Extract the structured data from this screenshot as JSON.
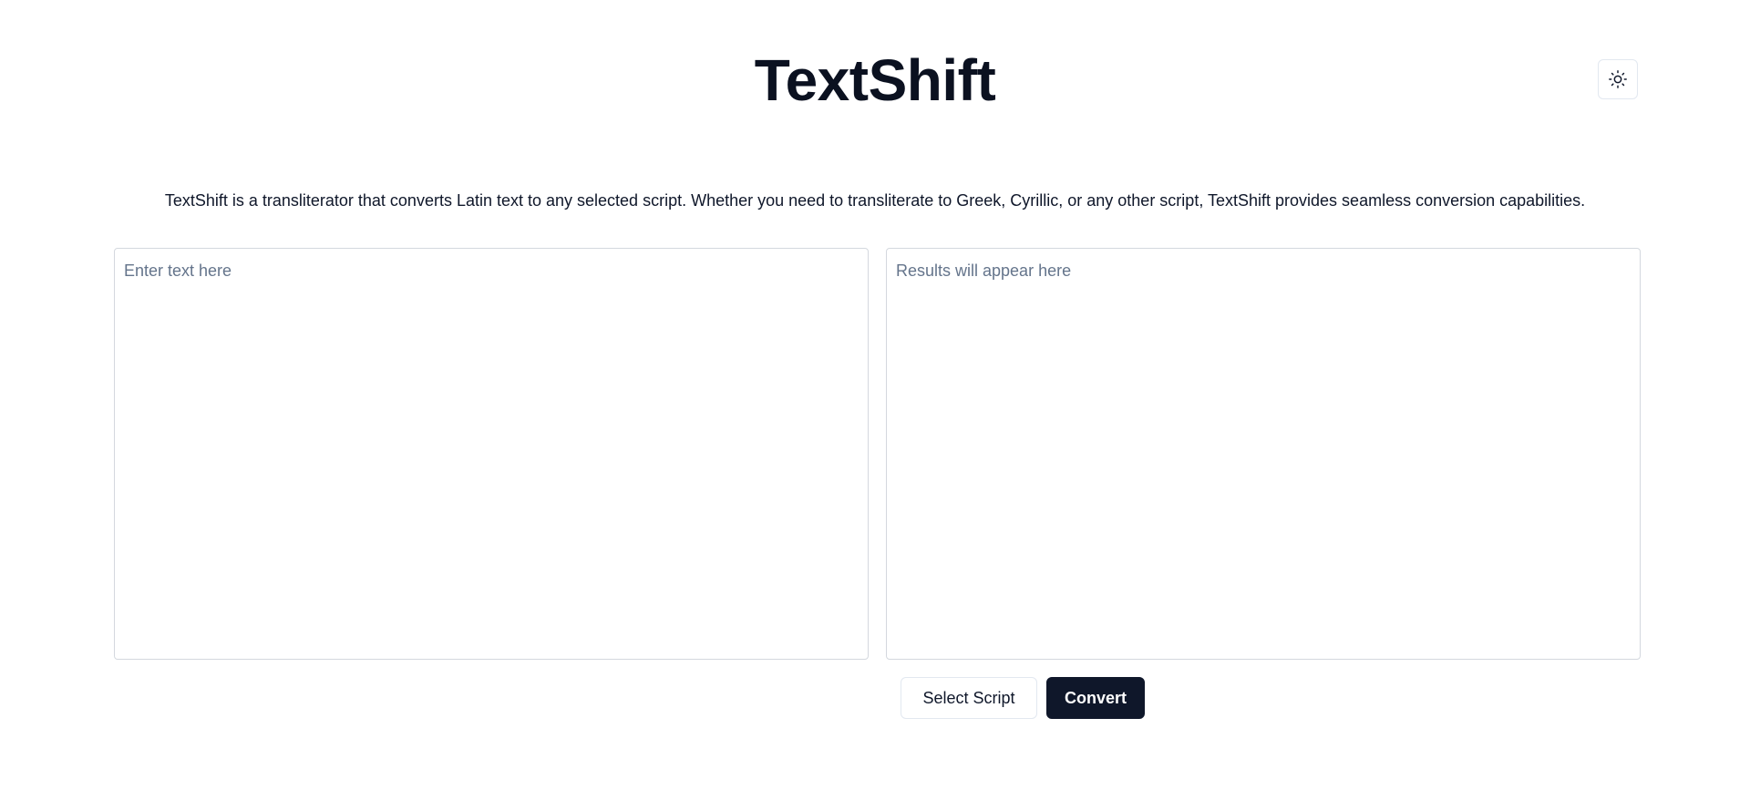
{
  "header": {
    "title": "TextShift",
    "theme_toggle_icon": "sun-icon"
  },
  "intro": {
    "description": "TextShift is a transliterator that converts Latin text to any selected script. Whether you need to transliterate to Greek, Cyrillic, or any other script, TextShift provides seamless conversion capabilities."
  },
  "editor": {
    "input_placeholder": "Enter text here",
    "input_value": "",
    "output_placeholder": "Results will appear here",
    "output_value": ""
  },
  "actions": {
    "select_script_label": "Select Script",
    "convert_label": "Convert"
  },
  "colors": {
    "primary": "#0f172a",
    "border": "#e2e8f0",
    "placeholder": "#64748b",
    "background": "#ffffff"
  }
}
